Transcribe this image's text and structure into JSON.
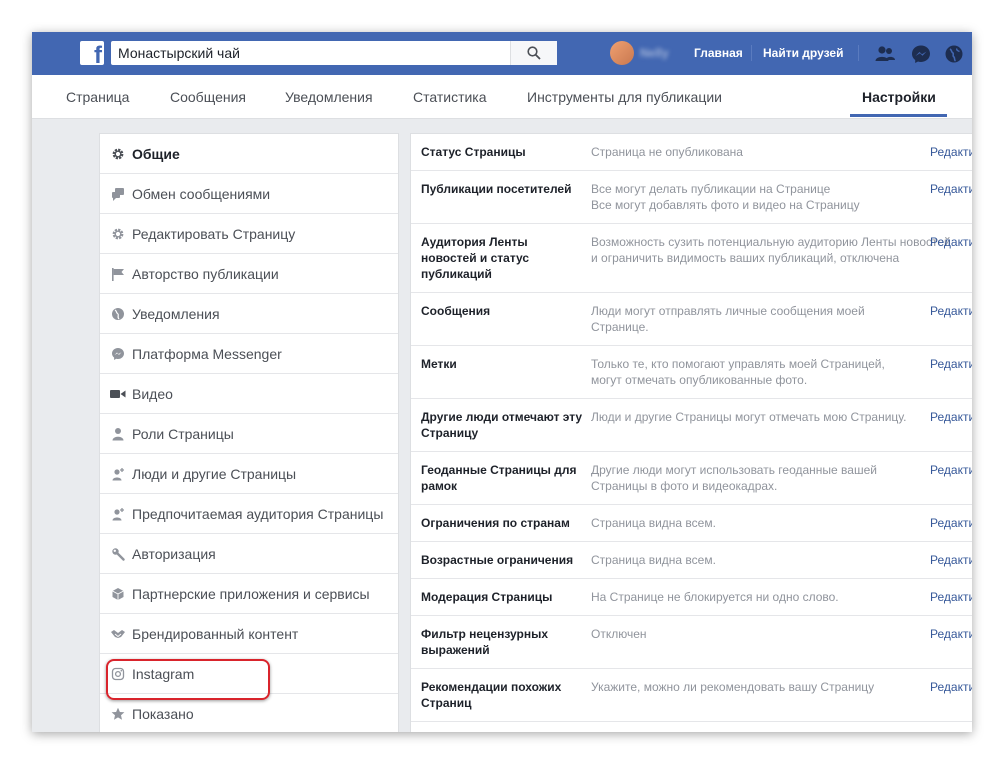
{
  "header": {
    "search_value": "Монастырский чай",
    "profile_name": "Nelly",
    "home_label": "Главная",
    "find_friends_label": "Найти друзей"
  },
  "tabs": [
    {
      "label": "Страница"
    },
    {
      "label": "Сообщения"
    },
    {
      "label": "Уведомления"
    },
    {
      "label": "Статистика"
    },
    {
      "label": "Инструменты для публикации"
    },
    {
      "label": "Настройки"
    }
  ],
  "sidebar": {
    "items": [
      {
        "label": "Общие",
        "icon": "gear-icon"
      },
      {
        "label": "Обмен сообщениями",
        "icon": "chat-icon"
      },
      {
        "label": "Редактировать Страницу",
        "icon": "gear-icon"
      },
      {
        "label": "Авторство публикации",
        "icon": "flag-icon"
      },
      {
        "label": "Уведомления",
        "icon": "globe-icon"
      },
      {
        "label": "Платформа Messenger",
        "icon": "messenger-icon"
      },
      {
        "label": "Видео",
        "icon": "video-camera-icon"
      },
      {
        "label": "Роли Страницы",
        "icon": "person-icon"
      },
      {
        "label": "Люди и другие Страницы",
        "icon": "person-add-icon"
      },
      {
        "label": "Предпочитаемая аудитория Страницы",
        "icon": "person-star-icon"
      },
      {
        "label": "Авторизация",
        "icon": "wrench-icon"
      },
      {
        "label": "Партнерские приложения и сервисы",
        "icon": "cube-icon"
      },
      {
        "label": "Брендированный контент",
        "icon": "handshake-icon"
      },
      {
        "label": "Instagram",
        "icon": "instagram-icon"
      },
      {
        "label": "Показано",
        "icon": "star-icon"
      }
    ]
  },
  "settings": {
    "edit_label": "Редакти",
    "rows": [
      {
        "label": "Статус Страницы",
        "value": "Страница не опубликована"
      },
      {
        "label": "Публикации посетителей",
        "value": "Все могут делать публикации на Странице",
        "value2": "Все могут добавлять фото и видео на Страницу"
      },
      {
        "label": "Аудитория Ленты новостей и статус публикаций",
        "value": "Возможность сузить потенциальную аудиторию Ленты новостей и ограничить видимость ваших публикаций, отключена"
      },
      {
        "label": "Сообщения",
        "value": "Люди могут отправлять личные сообщения моей Странице."
      },
      {
        "label": "Метки",
        "value": "Только те, кто помогают управлять моей Страницей, могут отмечать опубликованные фото."
      },
      {
        "label": "Другие люди отмечают эту Страницу",
        "value": "Люди и другие Страницы могут отмечать мою Страницу."
      },
      {
        "label": "Геоданные Страницы для рамок",
        "value": "Другие люди могут использовать геоданные вашей Страницы в фото и видеокадрах."
      },
      {
        "label": "Ограничения по странам",
        "value": "Страница видна всем."
      },
      {
        "label": "Возрастные ограничения",
        "value": "Страница видна всем."
      },
      {
        "label": "Модерация Страницы",
        "value": "На Странице не блокируется ни одно слово."
      },
      {
        "label": "Фильтр нецензурных выражений",
        "value": "Отключен"
      },
      {
        "label": "Рекомендации похожих Страниц",
        "value": "Укажите, можно ли рекомендовать вашу Страницу"
      }
    ]
  },
  "colors": {
    "brand_blue": "#4267b2",
    "link_blue": "#365899",
    "highlight_red": "#d9242c"
  }
}
